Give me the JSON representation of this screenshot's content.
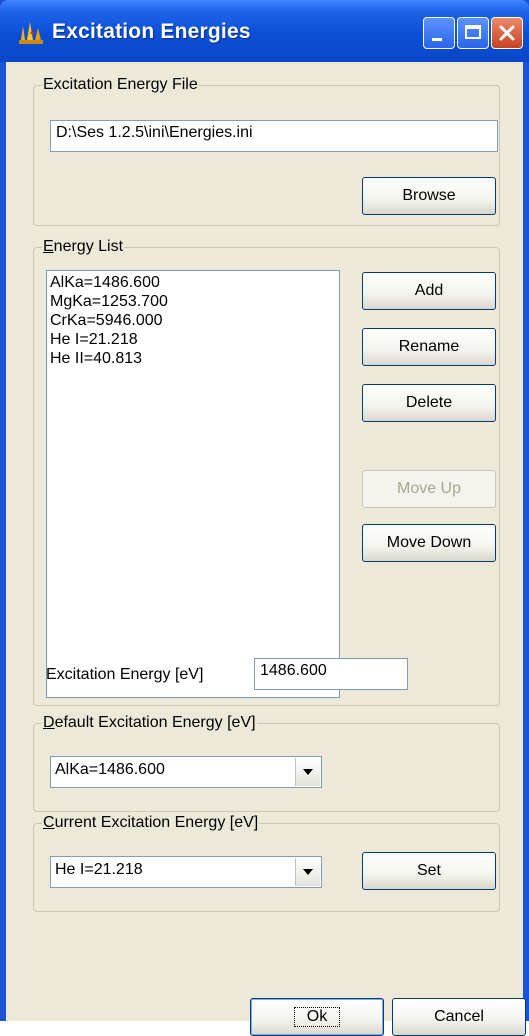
{
  "window": {
    "title": "Excitation Energies"
  },
  "file_group": {
    "legend": "Excitation Energy File",
    "path_value": "D:\\Ses 1.2.5\\ini\\Energies.ini",
    "browse_label": "Browse"
  },
  "energy_group": {
    "legend_first": "E",
    "legend_rest": "nergy List",
    "items": [
      "AlKa=1486.600",
      "MgKa=1253.700",
      "CrKa=5946.000",
      "He I=21.218",
      "He II=40.813"
    ],
    "add_label": "Add",
    "rename_label": "Rename",
    "delete_label": "Delete",
    "move_up_label": "Move Up",
    "move_down_label": "Move Down",
    "energy_label": "Excitation Energy [eV]",
    "energy_value": "1486.600"
  },
  "default_group": {
    "legend_first": "D",
    "legend_rest": "efault Excitation Energy [eV]",
    "selected": "AlKa=1486.600"
  },
  "current_group": {
    "legend_first": "C",
    "legend_rest": "urrent Excitation Energy [eV]",
    "selected": "He I=21.218",
    "set_label": "Set"
  },
  "footer": {
    "ok_label": "Ok",
    "cancel_label": "Cancel"
  },
  "colors": {
    "titlebar": "#0a4fd6",
    "client": "#ece9d8",
    "close_button": "#c8411f"
  }
}
